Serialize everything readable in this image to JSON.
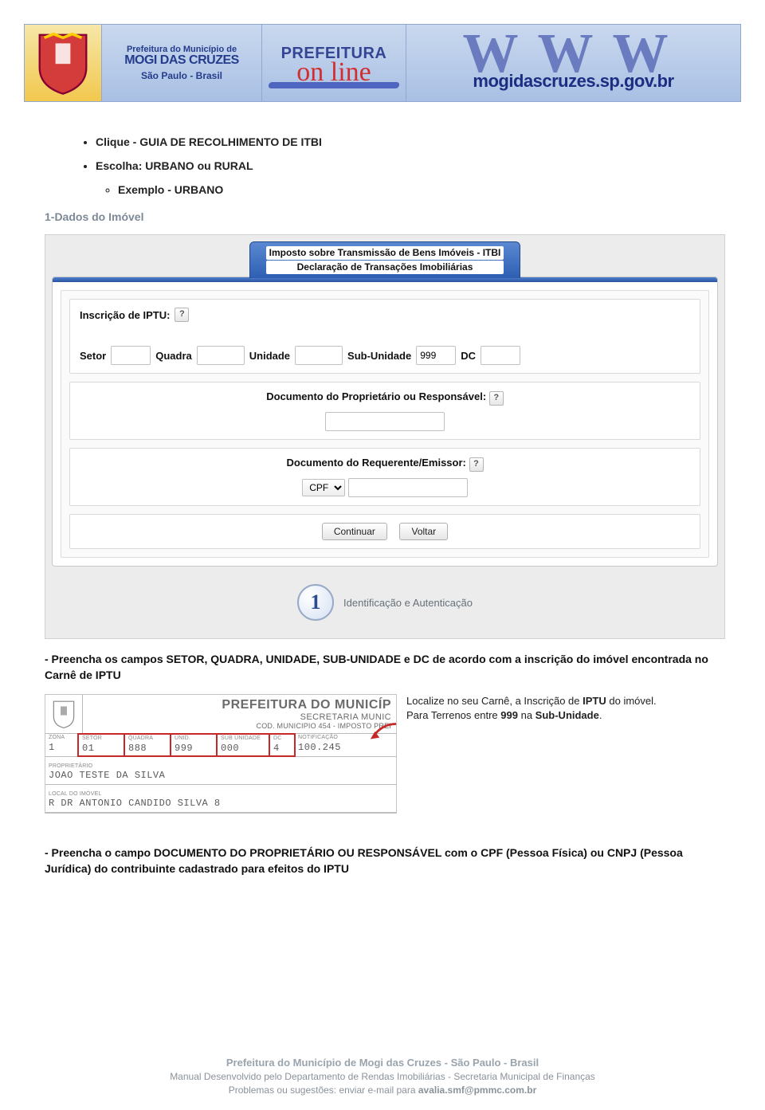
{
  "header": {
    "title_line1": "Prefeitura do Município de",
    "title_line2": "MOGI DAS CRUZES",
    "title_line3": "São Paulo - Brasil",
    "brand_top": "PREFEITURA",
    "brand_script": "on line",
    "url": "mogidascruzes.sp.gov.br"
  },
  "bullets": {
    "b1": "Clique - GUIA DE RECOLHIMENTO DE ITBI",
    "b2": "Escolha: URBANO ou RURAL",
    "sub1": "Exemplo - URBANO"
  },
  "step_heading": "1-Dados do Imóvel",
  "form": {
    "tab_line1": "Imposto sobre Transmissão de Bens Imóveis - ITBI",
    "tab_line2": "Declaração de Transações Imobiliárias",
    "iptu_label": "Inscrição de IPTU:",
    "setor_label": "Setor",
    "quadra_label": "Quadra",
    "unidade_label": "Unidade",
    "subunidade_label": "Sub-Unidade",
    "subunidade_value": "999",
    "dc_label": "DC",
    "doc_prop_label": "Documento do Proprietário ou Responsável:",
    "doc_req_label": "Documento do Requerente/Emissor:",
    "doc_type_option": "CPF",
    "btn_continue": "Continuar",
    "btn_back": "Voltar",
    "stage_number": "1",
    "stage_text": "Identificação e Autenticação",
    "help_glyph": "?"
  },
  "note1": "- Preencha os campos SETOR, QUADRA, UNIDADE, SUB-UNIDADE e DC de acordo com a inscrição do imóvel encontrada no Carnê de IPTU",
  "carne": {
    "title1": "PREFEITURA DO MUNICÍP",
    "title2": "SECRETARIA MUNIC",
    "title3": "COD. MUNICIPIO 454 - IMPOSTO PREI",
    "hdr_zona": "ZONA",
    "hdr_setor": "SETOR",
    "hdr_quadra": "QUADRA",
    "hdr_unid": "UNID.",
    "hdr_subunid": "SUB UNIDADE",
    "hdr_dc": "DC",
    "hdr_notif": "NOTIFICAÇÃO",
    "val_zona": "1",
    "val_setor": "01",
    "val_quadra": "888",
    "val_unid": "999",
    "val_subunid": "000",
    "val_dc": "4",
    "val_notif": "100.245",
    "hdr_prop": "PROPRIETÁRIO",
    "val_prop": "JOAO TESTE DA SILVA",
    "hdr_local": "LOCAL DO IMÓVEL",
    "val_local": "R DR ANTONIO CANDIDO SILVA  8"
  },
  "carne_note": {
    "l1a": "Localize no seu Carnê, a Inscrição de ",
    "l1b": "IPTU",
    "l1c": " do imóvel.",
    "l2a": "Para Terrenos entre ",
    "l2b": "999",
    "l2c": " na ",
    "l2d": "Sub-Unidade",
    "l2e": "."
  },
  "note2": "- Preencha o campo DOCUMENTO DO PROPRIETÁRIO OU RESPONSÁVEL com o CPF (Pessoa Física) ou CNPJ (Pessoa Jurídica) do contribuinte cadastrado para efeitos do IPTU",
  "footer": {
    "f1": "Prefeitura do Município de Mogi das Cruzes - São Paulo - Brasil",
    "f2": "Manual Desenvolvido pelo Departamento de Rendas Imobiliárias - Secretaria Municipal de Finanças",
    "f3a": "Problemas ou sugestões: enviar e-mail para ",
    "f3b": "avalia.smf@pmmc.com.br"
  }
}
